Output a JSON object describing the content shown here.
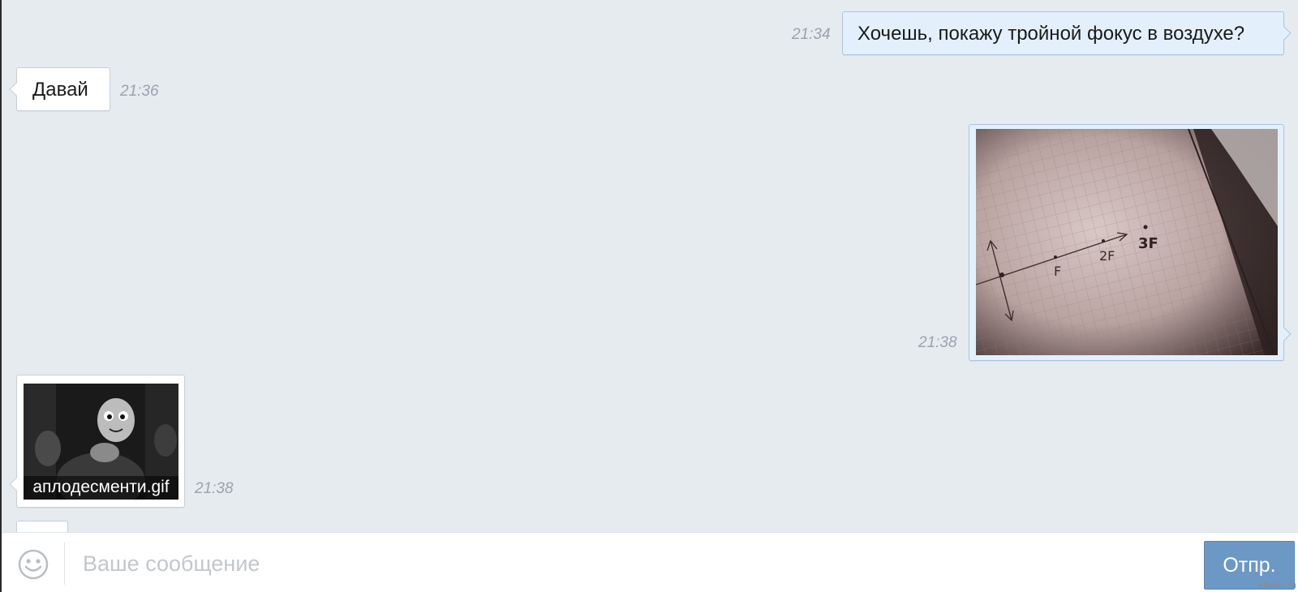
{
  "messages": [
    {
      "direction": "out",
      "text": "Хочешь, покажу тройной фокус в воздухе?",
      "time": "21:34"
    },
    {
      "direction": "in",
      "text": "Давай",
      "time": "21:36"
    },
    {
      "direction": "out",
      "type": "photo",
      "time": "21:38",
      "photo_labels": {
        "f": "F",
        "f2": "2F",
        "f3": "3F"
      }
    },
    {
      "direction": "in",
      "type": "gif",
      "filename": "аплодесменти.gif",
      "time": "21:38"
    }
  ],
  "composer": {
    "placeholder": "Ваше сообщение",
    "send_label": "Отпр.",
    "emoji_icon": "smiley-icon"
  },
  "watermark": "pikabu.ru",
  "colors": {
    "background": "#e6ebf0",
    "outgoing_bubble": "#e3f0fb",
    "incoming_bubble": "#ffffff",
    "send_button": "#6c98c6",
    "timestamp": "#9aa3ad"
  }
}
